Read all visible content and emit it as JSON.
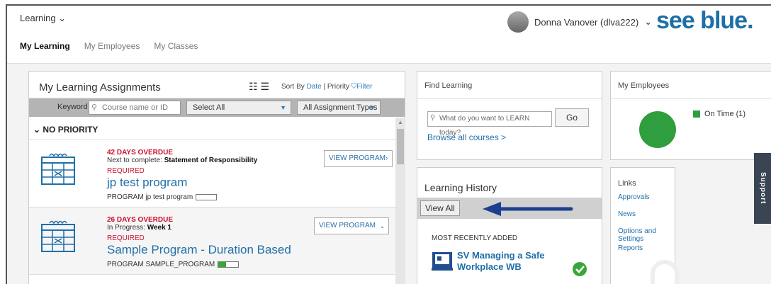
{
  "header": {
    "learning_menu": "Learning",
    "user_name": "Donna Vanover (dlva222)",
    "logo": "see blue."
  },
  "nav": {
    "tabs": [
      "My Learning",
      "My Employees",
      "My Classes"
    ]
  },
  "assignments": {
    "title": "My Learning Assignments",
    "sort_prefix": "Sort By",
    "sort_date": "Date",
    "sort_sep": "|",
    "sort_priority": "Priority",
    "filter": "Filter",
    "keyword_label": "Keyword",
    "keyword_placeholder": "Course name or ID",
    "select_all": "Select All",
    "assignment_types": "All Assignment Types",
    "group_label": "NO PRIORITY",
    "items": [
      {
        "overdue": "42 DAYS OVERDUE",
        "next_prefix": "Next to complete:",
        "next_value": "Statement of Responsibility",
        "required": "REQUIRED",
        "title": "jp test program",
        "code": "PROGRAM jp test program",
        "progress": 0,
        "button": "VIEW PROGRAM›"
      },
      {
        "overdue": "26 DAYS OVERDUE",
        "next_prefix": "In Progress:",
        "next_value": "Week 1",
        "required": "REQUIRED",
        "title": "Sample Program - Duration Based",
        "code": "PROGRAM SAMPLE_PROGRAM",
        "progress": 0.4,
        "button": "VIEW PROGRAM"
      }
    ]
  },
  "find_learning": {
    "title": "Find Learning",
    "search_placeholder": "What do you want to LEARN today?",
    "go": "Go",
    "browse": "Browse all courses >"
  },
  "employees": {
    "title": "My Employees",
    "legend": "On Time (1)",
    "on_time_color": "#2e9e3e"
  },
  "history": {
    "title": "Learning History",
    "view_all": "View All",
    "most_recent": "MOST RECENTLY ADDED",
    "course_line1": "SV Managing a Safe",
    "course_line2": "Workplace WB"
  },
  "links": {
    "title": "Links",
    "items": [
      "Approvals",
      "News",
      "Options and Settings",
      "Reports"
    ]
  },
  "support": "Support"
}
